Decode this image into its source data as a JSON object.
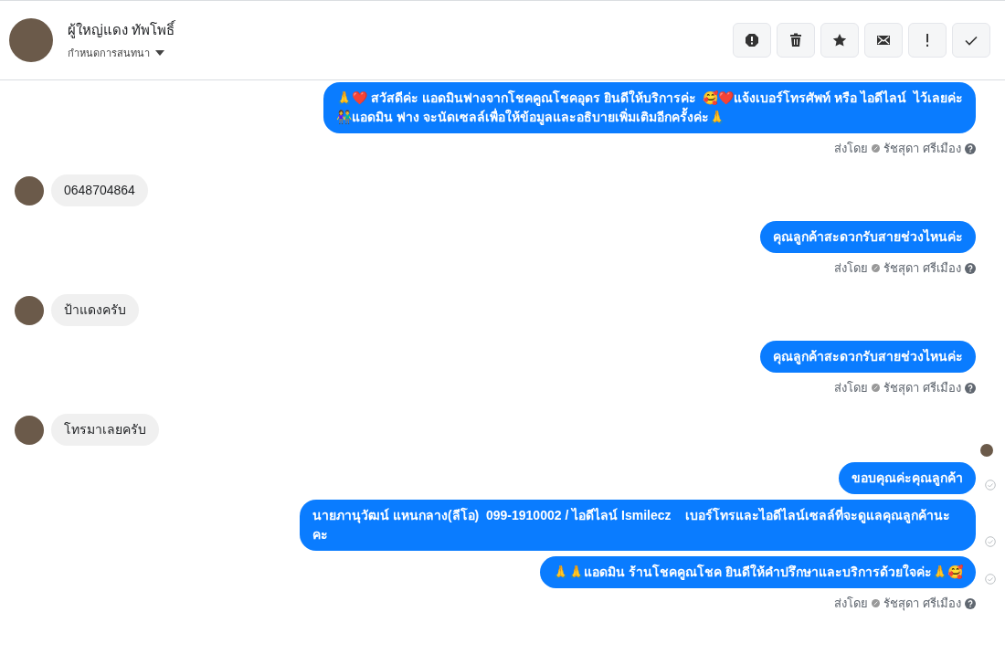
{
  "header": {
    "name": "ผู้ใหญ่แดง ทัพโพธิ์",
    "subtitle": "กำหนดการสนทนา"
  },
  "actions": [
    {
      "kind": "alert"
    },
    {
      "kind": "delete"
    },
    {
      "kind": "star"
    },
    {
      "kind": "mail"
    },
    {
      "kind": "important"
    },
    {
      "kind": "done"
    }
  ],
  "messages": [
    {
      "kind": "out",
      "text": "🙏❤️ สวัสดีค่ะ แอดมินฟางจากโชคคูณโชคอุดร ยินดีให้บริการค่ะ  🥰❤️แจ้งเบอร์โทรศัพท์ หรือ ไอดีไลน์  ไว้เลยค่ะ\n👫แอดมิน ฟาง จะนัดเซลล์เพื่อให้ข้อมูลและอธิบายเพิ่มเติมอีกครั้งค่ะ🙏",
      "delivered": false
    },
    {
      "kind": "sender",
      "label": "ส่งโดย",
      "name": "รัชสุดา ศรีเมือง"
    },
    {
      "kind": "in",
      "text": "0648704864"
    },
    {
      "kind": "out",
      "text": "คุณลูกค้าสะดวกรับสายช่วงไหนค่ะ",
      "delivered": false
    },
    {
      "kind": "sender",
      "label": "ส่งโดย",
      "name": "รัชสุดา ศรีเมือง"
    },
    {
      "kind": "in",
      "text": "ป้าแดงครับ"
    },
    {
      "kind": "out",
      "text": "คุณลูกค้าสะดวกรับสายช่วงไหนค่ะ",
      "delivered": false
    },
    {
      "kind": "sender",
      "label": "ส่งโดย",
      "name": "รัชสุดา ศรีเมือง"
    },
    {
      "kind": "in",
      "text": "โทรมาเลยครับ"
    },
    {
      "kind": "seen"
    },
    {
      "kind": "out",
      "text": "ขอบคุณค่ะคุณลูกค้า",
      "delivered": true
    },
    {
      "kind": "out",
      "text": "นายภานุวัฒน์ แหนกลาง(ลีโอ)  099-1910002 / ไอดีไลน์ Ismilecz    เบอร์โทรและไอดีไลน์เซลล์ที่จะดูแลคุณลูกค้านะคะ",
      "delivered": true
    },
    {
      "kind": "out",
      "text": "🙏🙏แอดมิน ร้านโชคคูณโชค ยินดีให้คำปรึกษาและบริการด้วยใจค่ะ🙏🥰",
      "delivered": true
    },
    {
      "kind": "sender",
      "label": "ส่งโดย",
      "name": "รัชสุดา ศรีเมือง"
    }
  ]
}
